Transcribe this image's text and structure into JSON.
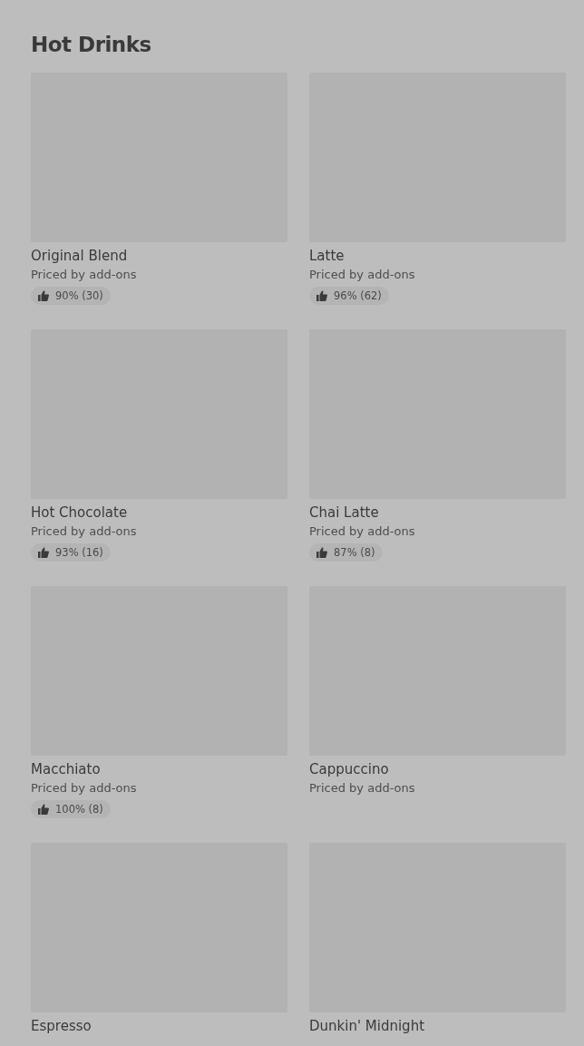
{
  "section": {
    "title": "Hot Drinks"
  },
  "items": [
    {
      "name": "Original Blend",
      "price": "Priced by add-ons",
      "rating": "90% (30)"
    },
    {
      "name": "Latte",
      "price": "Priced by add-ons",
      "rating": "96% (62)"
    },
    {
      "name": "Hot Chocolate",
      "price": "Priced by add-ons",
      "rating": "93% (16)"
    },
    {
      "name": "Chai Latte",
      "price": "Priced by add-ons",
      "rating": "87% (8)"
    },
    {
      "name": "Macchiato",
      "price": "Priced by add-ons",
      "rating": "100% (8)"
    },
    {
      "name": "Cappuccino",
      "price": "Priced by add-ons"
    },
    {
      "name": "Espresso"
    },
    {
      "name": "Dunkin' Midnight"
    }
  ]
}
